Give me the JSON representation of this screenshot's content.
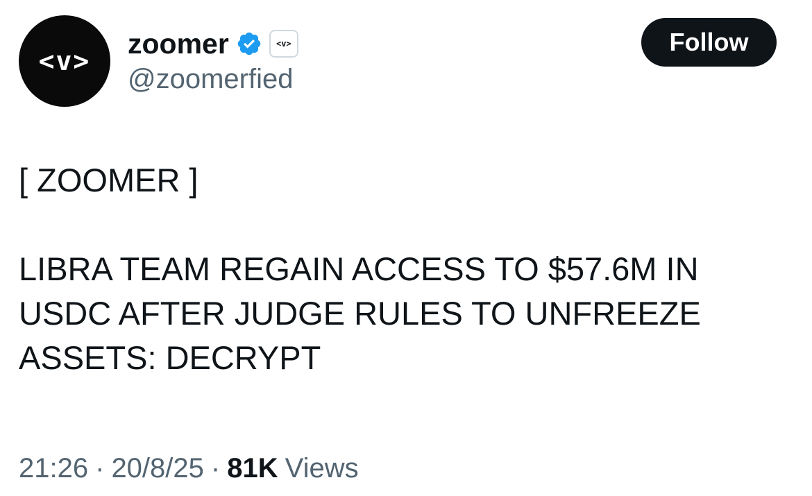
{
  "author": {
    "avatar_text": "<v>",
    "display_name": "zoomer",
    "verified_icon": "verified-badge-icon",
    "verified_color": "#1d9bf0",
    "affiliate_badge_text": "<v>",
    "handle": "@zoomerfied"
  },
  "actions": {
    "follow_label": "Follow"
  },
  "tweet": {
    "text": "[ ZOOMER ]\n\nLIBRA TEAM REGAIN ACCESS TO $57.6M IN USDC AFTER JUDGE RULES TO UNFREEZE ASSETS: DECRYPT"
  },
  "meta": {
    "time": "21:26",
    "date": "20/8/25",
    "separator": "·",
    "views_count": "81K",
    "views_label": "Views"
  }
}
